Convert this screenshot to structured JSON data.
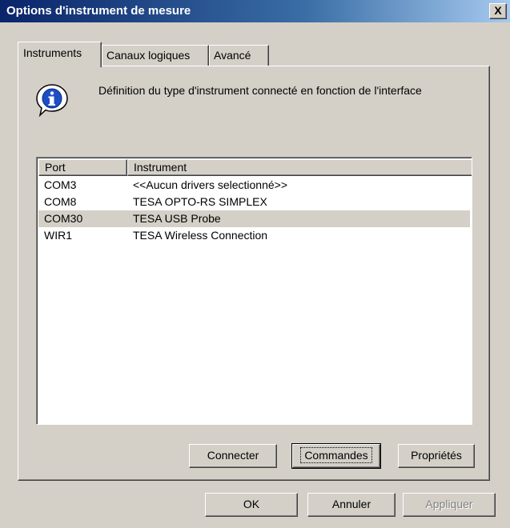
{
  "window": {
    "title": "Options d'instrument de mesure",
    "close_label": "X"
  },
  "tabs": [
    {
      "label": "Instruments"
    },
    {
      "label": "Canaux logiques"
    },
    {
      "label": "Avancé"
    }
  ],
  "panel": {
    "info_icon": "info-balloon-icon",
    "description": "Définition du type d'instrument connecté en fonction de l'interface"
  },
  "list": {
    "columns": [
      "Port",
      "Instrument"
    ],
    "rows": [
      {
        "port": "COM3",
        "instrument": "<<Aucun drivers selectionné>>"
      },
      {
        "port": "COM8",
        "instrument": "TESA OPTO-RS SIMPLEX"
      },
      {
        "port": "COM30",
        "instrument": "TESA USB Probe"
      },
      {
        "port": "WIR1",
        "instrument": "TESA Wireless Connection"
      }
    ],
    "selected_index": 2
  },
  "panel_buttons": {
    "connect": "Connecter",
    "commands": "Commandes",
    "properties": "Propriétés"
  },
  "dialog_buttons": {
    "ok": "OK",
    "cancel": "Annuler",
    "apply": "Appliquer"
  },
  "colors": {
    "title_gradient_start": "#0a246a",
    "title_gradient_end": "#a6caf0",
    "face": "#d4d0c8"
  }
}
